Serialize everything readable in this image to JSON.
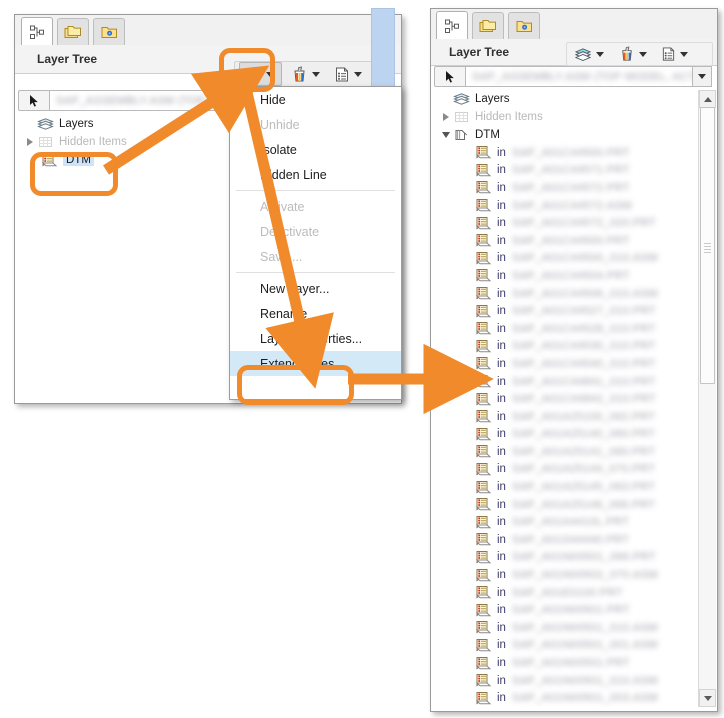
{
  "accent": {
    "annotation_orange": "#f08a2a",
    "selection_blue": "#cde3f7",
    "menu_highlight_blue": "#d4e9f7",
    "marker_blue": "#bdd4f0"
  },
  "left_panel": {
    "tabs": [
      {
        "name": "model-tree-tab",
        "icon": "model-tree-icon",
        "active": true
      },
      {
        "name": "folders-tab",
        "icon": "folders-icon",
        "active": false
      },
      {
        "name": "favorites-folder-tab",
        "icon": "folder-gem-icon",
        "active": false
      }
    ],
    "title": "Layer Tree",
    "toolbar": [
      {
        "name": "layers-dropdown-button",
        "icon": "layers-stack-icon",
        "pressed": true
      },
      {
        "name": "display-style-dropdown-button",
        "icon": "paint-tools-icon",
        "pressed": false
      },
      {
        "name": "rules-dropdown-button",
        "icon": "rules-list-icon",
        "pressed": false
      }
    ],
    "filter": {
      "cursor_button": "select-cursor-icon",
      "value": "SAP_ASSEMBLY.ASM  (TOP MO",
      "placeholder": "",
      "redacted": true
    },
    "tree": [
      {
        "label": "Layers",
        "icon": "layers-stack-icon",
        "indent": 0,
        "twisty": "none",
        "state": "normal"
      },
      {
        "label": "Hidden Items",
        "icon": "hidden-items-icon",
        "indent": 1,
        "twisty": "collapsed",
        "state": "ghost"
      },
      {
        "label": "DTM",
        "icon": "layer-sheet-icon",
        "indent": 1,
        "twisty": "none",
        "state": "selected"
      }
    ]
  },
  "context_menu": {
    "items": [
      {
        "label": "Hide",
        "state": "normal"
      },
      {
        "label": "Unhide",
        "state": "disabled"
      },
      {
        "label": "Isolate",
        "state": "normal"
      },
      {
        "label": "Hidden Line",
        "state": "normal"
      },
      {
        "separator": true
      },
      {
        "label": "Activate",
        "state": "disabled"
      },
      {
        "label": "Deactivate",
        "state": "disabled"
      },
      {
        "label": "Save ...",
        "state": "disabled"
      },
      {
        "separator": true
      },
      {
        "label": "New Layer...",
        "state": "normal"
      },
      {
        "label": "Rename",
        "state": "normal"
      },
      {
        "label": "Layer Properties...",
        "state": "normal"
      },
      {
        "label": "Extend Rules",
        "state": "highlighted"
      }
    ]
  },
  "right_panel": {
    "tabs": [
      {
        "name": "model-tree-tab",
        "icon": "model-tree-icon",
        "active": true
      },
      {
        "name": "folders-tab",
        "icon": "folders-icon",
        "active": false
      },
      {
        "name": "favorites-folder-tab",
        "icon": "folder-gem-icon",
        "active": false
      }
    ],
    "title": "Layer Tree",
    "toolbar": [
      {
        "name": "layers-dropdown-button",
        "icon": "layers-stack-icon",
        "pressed": false
      },
      {
        "name": "display-style-dropdown-button",
        "icon": "paint-tools-icon",
        "pressed": false
      },
      {
        "name": "rules-dropdown-button",
        "icon": "rules-list-icon",
        "pressed": false
      }
    ],
    "filter": {
      "cursor_button": "select-cursor-icon",
      "value": "SAP_ASSEMBLY.ASM (TOP MODEL, ACTIVE)",
      "redacted": true
    },
    "tree_header": [
      {
        "label": "Layers",
        "icon": "layers-stack-icon",
        "indent": 0,
        "twisty": "none",
        "state": "normal"
      },
      {
        "label": "Hidden Items",
        "icon": "hidden-items-icon",
        "indent": 1,
        "twisty": "collapsed",
        "state": "ghost"
      },
      {
        "label": "DTM",
        "icon": "layer-open-icon",
        "indent": 1,
        "twisty": "expanded",
        "state": "normal"
      }
    ],
    "item_prefix": "in",
    "items": [
      {
        "prefix": "in",
        "name": "SAP_A01C44500.PRT"
      },
      {
        "prefix": "in",
        "name": "SAP_A01C44571.PRT"
      },
      {
        "prefix": "in",
        "name": "SAP_A01C44572.PRT"
      },
      {
        "prefix": "in",
        "name": "SAP_A01C44572.ASM"
      },
      {
        "prefix": "in",
        "name": "SAP_A01C44572_020.PRT"
      },
      {
        "prefix": "in",
        "name": "SAP_A01C44500.PRT"
      },
      {
        "prefix": "in",
        "name": "SAP_A01C44500_010.ASM"
      },
      {
        "prefix": "in",
        "name": "SAP_A01C44504.PRT"
      },
      {
        "prefix": "in",
        "name": "SAP_A01C44506_010.ASM"
      },
      {
        "prefix": "in",
        "name": "SAP_A01C44527_010.PRT"
      },
      {
        "prefix": "in",
        "name": "SAP_A01C44528_010.PRT"
      },
      {
        "prefix": "in",
        "name": "SAP_A01C44530_010.PRT"
      },
      {
        "prefix": "in",
        "name": "SAP_A01C44540_010.PRT"
      },
      {
        "prefix": "in",
        "name": "SAP_A01C44841_010.PRT"
      },
      {
        "prefix": "in",
        "name": "SAP_A01C44842_010.PRT"
      },
      {
        "prefix": "in",
        "name": "SAP_A01A25100_062.PRT"
      },
      {
        "prefix": "in",
        "name": "SAP_A01A25140_060.PRT"
      },
      {
        "prefix": "in",
        "name": "SAP_A01A25141_060.PRT"
      },
      {
        "prefix": "in",
        "name": "SAP_A01A25144_070.PRT"
      },
      {
        "prefix": "in",
        "name": "SAP_A01A25145_063.PRT"
      },
      {
        "prefix": "in",
        "name": "SAP_A01A25146_066.PRT"
      },
      {
        "prefix": "in",
        "name": "SAP_A01A4410L.PRT"
      },
      {
        "prefix": "in",
        "name": "SAP_A01S44440.PRT"
      },
      {
        "prefix": "in",
        "name": "SAP_A01N00501_066.PRT"
      },
      {
        "prefix": "in",
        "name": "SAP_A01N00502_070.ASM"
      },
      {
        "prefix": "in",
        "name": "SAP_A01E0100.PRT"
      },
      {
        "prefix": "in",
        "name": "SAP_A01N00501.PRT"
      },
      {
        "prefix": "in",
        "name": "SAP_A01N00501_010.ASM"
      },
      {
        "prefix": "in",
        "name": "SAP_A01N00501_001.ASM"
      },
      {
        "prefix": "in",
        "name": "SAP_A01N00501.PRT"
      },
      {
        "prefix": "in",
        "name": "SAP_A01N00501_010.ASM"
      },
      {
        "prefix": "in",
        "name": "SAP_A01N00501_003.ASM"
      }
    ],
    "scrollbar": {
      "up": "scroll-up-arrow",
      "down": "scroll-down-arrow"
    }
  },
  "annotations": {
    "highlight_boxes": [
      {
        "name": "layers-dropdown-button-highlight"
      },
      {
        "name": "dtm-layer-highlight"
      },
      {
        "name": "extend-rules-highlight"
      }
    ],
    "arrows": [
      {
        "name": "arrow-dtm-to-layers-button",
        "from": "DTM layer",
        "to": "layers dropdown button"
      },
      {
        "name": "arrow-layers-button-to-menu",
        "from": "layers dropdown button",
        "to": "Layer Properties menu area"
      },
      {
        "name": "arrow-extend-rules-to-tree",
        "from": "Extend Rules",
        "to": "expanded layer tree"
      }
    ]
  }
}
